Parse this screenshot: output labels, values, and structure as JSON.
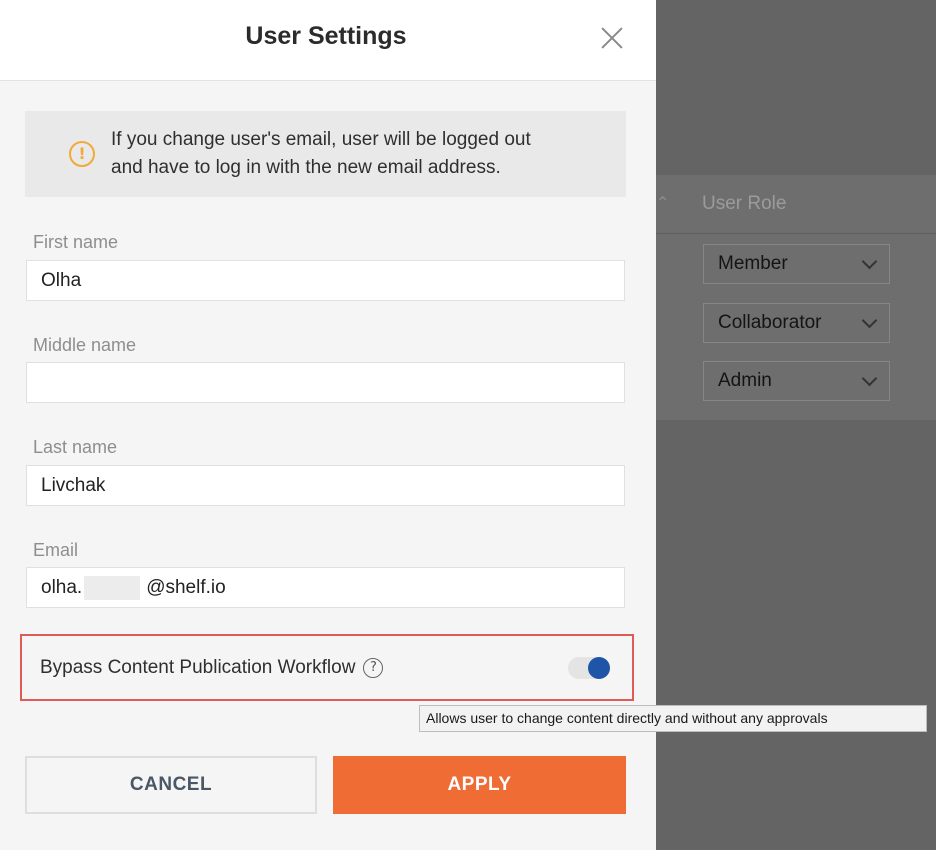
{
  "background": {
    "column_title": "User Role",
    "sort_icon": "sort-icon",
    "role_selects": [
      {
        "value": "Member"
      },
      {
        "value": "Collaborator"
      },
      {
        "value": "Admin"
      }
    ]
  },
  "modal": {
    "title": "User Settings",
    "close_icon": "close-icon",
    "notice": {
      "icon": "warning-icon",
      "line1": "If you change user's email, user will be logged out",
      "line2": "and have to log in with the new email address."
    },
    "fields": {
      "first_name": {
        "label": "First name",
        "value": "Olha"
      },
      "middle_name": {
        "label": "Middle name",
        "value": ""
      },
      "last_name": {
        "label": "Last name",
        "value": "Livchak"
      },
      "email": {
        "label": "Email",
        "value_prefix": "olha.",
        "value_suffix": "@shelf.io"
      }
    },
    "bypass": {
      "label": "Bypass Content Publication Workflow",
      "help_icon": "question-icon",
      "help_glyph": "?",
      "enabled": true,
      "tooltip": "Allows user to change content directly and without any approvals"
    },
    "buttons": {
      "cancel": "CANCEL",
      "apply": "APPLY"
    }
  },
  "colors": {
    "accent": "#ef6c34",
    "toggle_on": "#1f55a6",
    "warning": "#f2a93b",
    "highlight_border": "#e05a58"
  }
}
